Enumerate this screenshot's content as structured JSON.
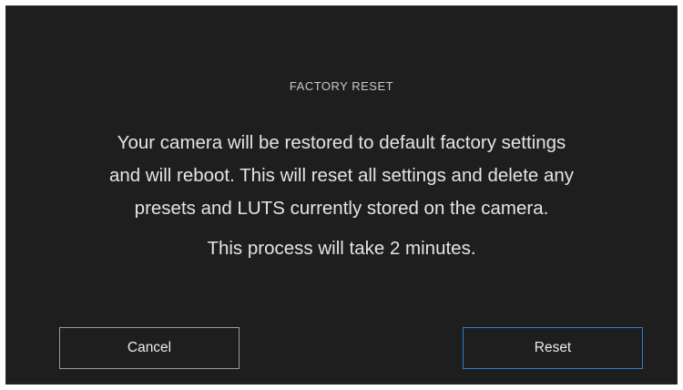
{
  "dialog": {
    "title": "FACTORY RESET",
    "message_lines": [
      "Your camera will be restored to default factory settings",
      "and will reboot. This will reset all settings and delete any",
      "presets and LUTS currently stored on the camera."
    ],
    "note": "This process will take 2 minutes.",
    "cancel_label": "Cancel",
    "reset_label": "Reset"
  },
  "colors": {
    "background": "#1e1e1e",
    "accent": "#2f7fc9",
    "text": "#e4e4e4"
  }
}
